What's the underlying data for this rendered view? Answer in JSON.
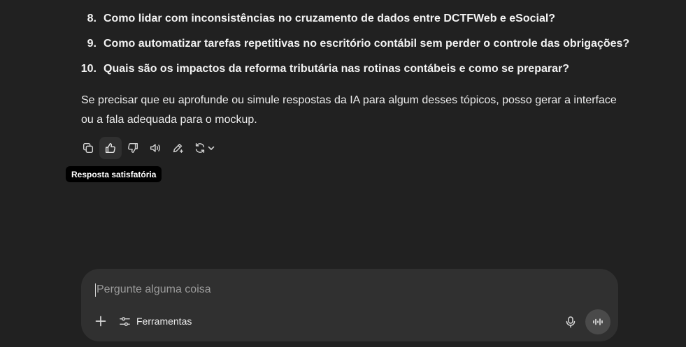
{
  "list": {
    "items": [
      {
        "num": "8.",
        "text": "Como lidar com inconsistências no cruzamento de dados entre DCTFWeb e eSocial?"
      },
      {
        "num": "9.",
        "text": "Como automatizar tarefas repetitivas no escritório contábil sem perder o controle das obrigações?"
      },
      {
        "num": "10.",
        "text": "Quais são os impactos da reforma tributária nas rotinas contábeis e como se preparar?"
      }
    ]
  },
  "message": {
    "paragraph": "Se precisar que eu aprofunde ou simule respostas da IA para algum desses tópicos, posso gerar a interface ou a fala adequada para o mockup."
  },
  "actions": {
    "icons": [
      "copy-icon",
      "thumbs-up-icon",
      "thumbs-down-icon",
      "read-aloud-icon",
      "edit-icon",
      "regenerate-icon",
      "chevron-down-icon"
    ],
    "hovered": "thumbs-up-icon",
    "tooltip": "Resposta satisfatória"
  },
  "composer": {
    "placeholder": "Pergunte alguma coisa",
    "tools_label": "Ferramentas",
    "icons": [
      "plus-icon",
      "sliders-icon",
      "microphone-icon",
      "voice-mode-icon"
    ]
  },
  "colors": {
    "background": "#212121",
    "composer": "#303030",
    "tooltip": "#000000",
    "voice_button": "#4a4a4a"
  }
}
